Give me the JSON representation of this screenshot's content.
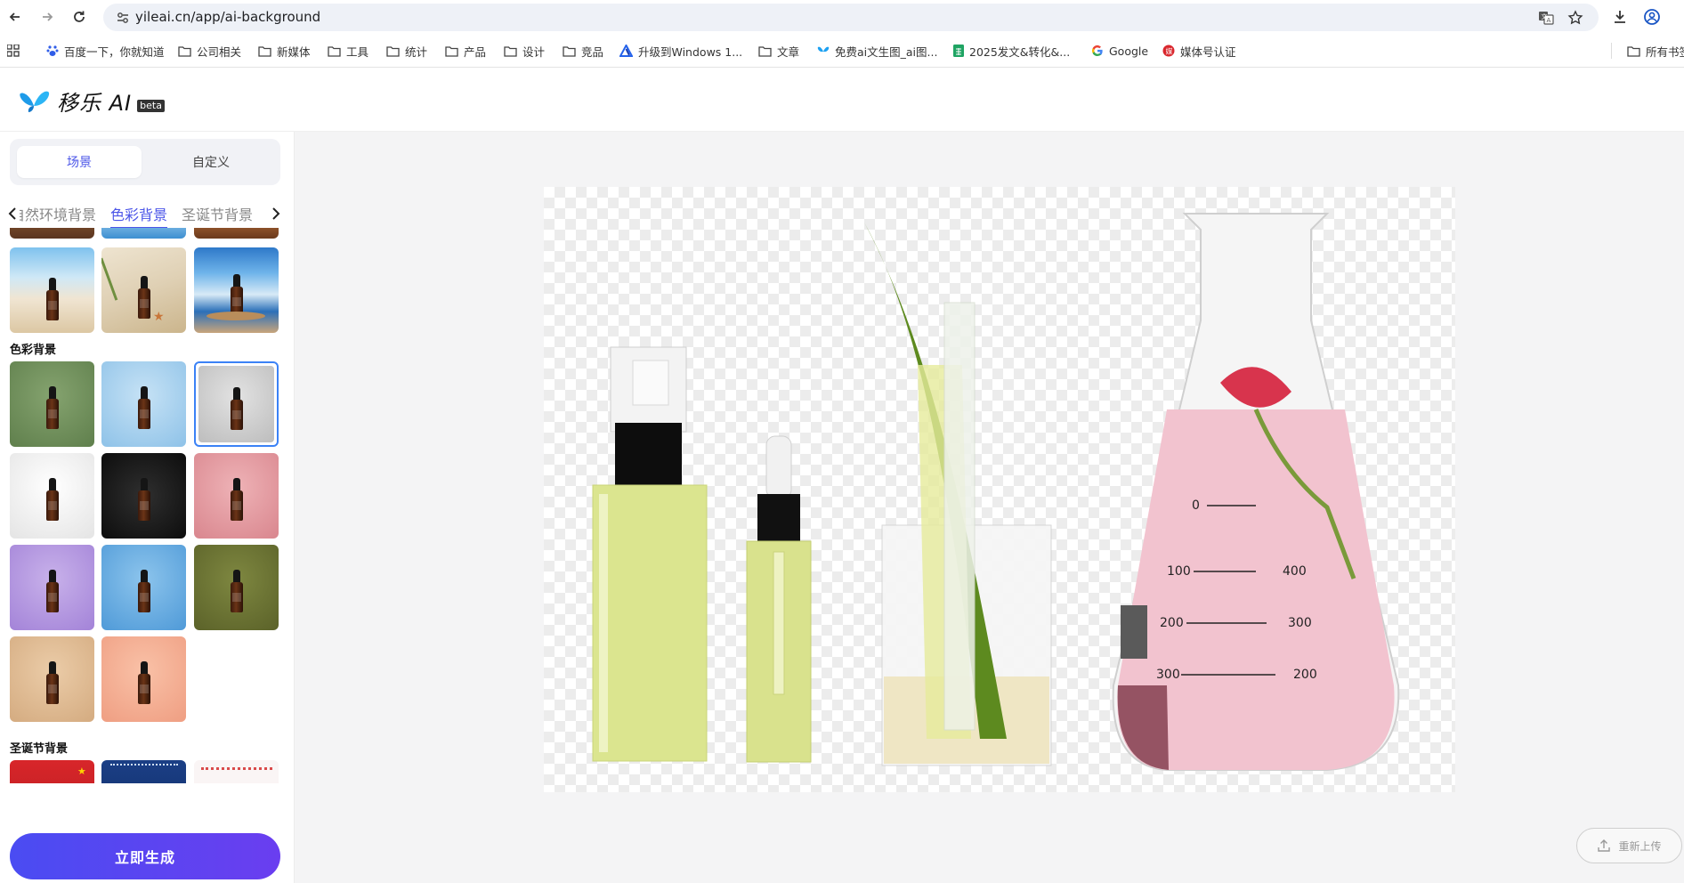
{
  "browser": {
    "url": "yileai.cn/app/ai-background",
    "bookmarks": [
      {
        "label": "百度一下，你就知道",
        "icon": "baidu-paw-icon"
      },
      {
        "label": "公司相关",
        "icon": "folder-icon"
      },
      {
        "label": "新媒体",
        "icon": "folder-icon"
      },
      {
        "label": "工具",
        "icon": "folder-icon"
      },
      {
        "label": "统计",
        "icon": "folder-icon"
      },
      {
        "label": "产品",
        "icon": "folder-icon"
      },
      {
        "label": "设计",
        "icon": "folder-icon"
      },
      {
        "label": "竞品",
        "icon": "folder-icon"
      },
      {
        "label": "升级到Windows 1...",
        "icon": "triangle-logo-icon"
      },
      {
        "label": "文章",
        "icon": "folder-icon"
      },
      {
        "label": "免费ai文生图_ai图...",
        "icon": "butterfly-icon"
      },
      {
        "label": "2025发文&转化&...",
        "icon": "sheet-icon"
      },
      {
        "label": "Google",
        "icon": "google-icon"
      },
      {
        "label": "媒体号认证",
        "icon": "weibo-icon"
      },
      {
        "label": "所有书签",
        "icon": "folder-icon"
      }
    ]
  },
  "app": {
    "name": "移乐 AI",
    "badge": "beta"
  },
  "sidebar": {
    "mode_tabs": [
      {
        "label": "场景",
        "active": true
      },
      {
        "label": "自定义",
        "active": false
      }
    ],
    "category_tabs": [
      {
        "label": "自然环境背景",
        "active": false
      },
      {
        "label": "色彩背景",
        "active": true
      },
      {
        "label": "圣诞节背景",
        "active": false
      }
    ],
    "sections": [
      {
        "title": "色彩背景"
      },
      {
        "title": "圣诞节背景"
      }
    ],
    "nature_thumbs": [
      "leaf-on-wood",
      "blue-water-splash",
      "wood-tabletop",
      "beach-sand-sea",
      "palm-leaf-starfish",
      "ocean-tray-shell"
    ],
    "color_thumbs": [
      {
        "name": "green",
        "color": "#6f8f5c",
        "selected": false
      },
      {
        "name": "light-blue",
        "color": "#a9d0ec",
        "selected": false
      },
      {
        "name": "light-gray",
        "color": "#cfcfcf",
        "selected": true
      },
      {
        "name": "white",
        "color": "#f2f2f2",
        "selected": false
      },
      {
        "name": "black",
        "color": "#1a1a1a",
        "selected": false
      },
      {
        "name": "pink",
        "color": "#e4999f",
        "selected": false
      },
      {
        "name": "lavender",
        "color": "#b79be0",
        "selected": false
      },
      {
        "name": "sky-blue",
        "color": "#6aaee0",
        "selected": false
      },
      {
        "name": "olive",
        "color": "#6a7233",
        "selected": false
      },
      {
        "name": "tan",
        "color": "#e0bd97",
        "selected": false
      },
      {
        "name": "peach",
        "color": "#f4ae94",
        "selected": false
      }
    ],
    "generate_label": "立即生成"
  },
  "main": {
    "reupload_label": "重新上传",
    "preview": {
      "flask_marks_left": [
        "0",
        "100",
        "200",
        "300"
      ],
      "flask_marks_right": [
        "400",
        "300",
        "200"
      ]
    }
  },
  "colors": {
    "accent": "#4b55e8",
    "selection": "#3b82f6",
    "canvas_bg": "#f4f4f5"
  }
}
